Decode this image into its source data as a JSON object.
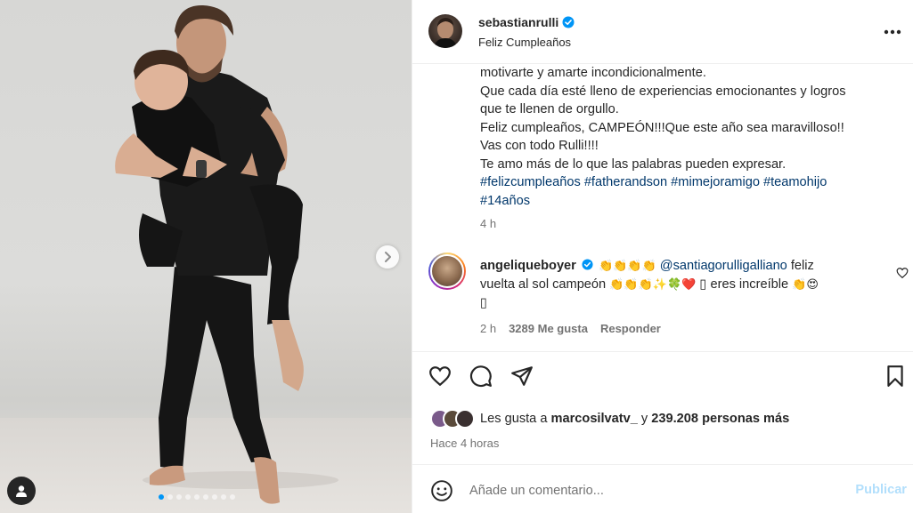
{
  "post": {
    "username": "sebastianrulli",
    "subtitle": "Feliz Cumpleaños",
    "caption_lines": [
      "motivarte y amarte incondicionalmente.",
      "Que cada día esté lleno de experiencias emocionantes y logros",
      "que te llenen de orgullo.",
      "Feliz cumpleaños, CAMPEÓN!!!Que este año sea maravilloso!!",
      "Vas con todo Rulli!!!!",
      "Te amo más de lo que las palabras pueden expresar."
    ],
    "hashtags_line1": "#felizcumpleaños #fatherandson #mimejoramigo #teamohijo",
    "hashtags_line2": "#14años",
    "caption_time": "4 h"
  },
  "comment": {
    "username": "angeliqueboyer",
    "emojis_1": "👏👏👏👏",
    "mention": "@santiagorulligalliano",
    "text_1": " feliz",
    "text_2": "vuelta al sol campeón ",
    "emojis_2": "👏👏👏✨🍀❤️",
    "box_1": "▯",
    "text_3": " eres increíble ",
    "emojis_3": "👏😍",
    "box_2": "▯",
    "time": "2 h",
    "likes": "3289 Me gusta",
    "reply": "Responder"
  },
  "likes": {
    "prefix": "Les gusta a ",
    "user": "marcosilvatv_",
    "suffix": " y ",
    "count": "239.208 personas más"
  },
  "ago": "Hace 4 horas",
  "composer": {
    "placeholder": "Añade un comentario...",
    "post_label": "Publicar"
  },
  "carousel": {
    "total": 9,
    "active_index": 0
  },
  "colors": {
    "link": "#00376b",
    "verified": "#0095f6",
    "muted": "#737373",
    "publish_disabled": "#b2dffc"
  }
}
